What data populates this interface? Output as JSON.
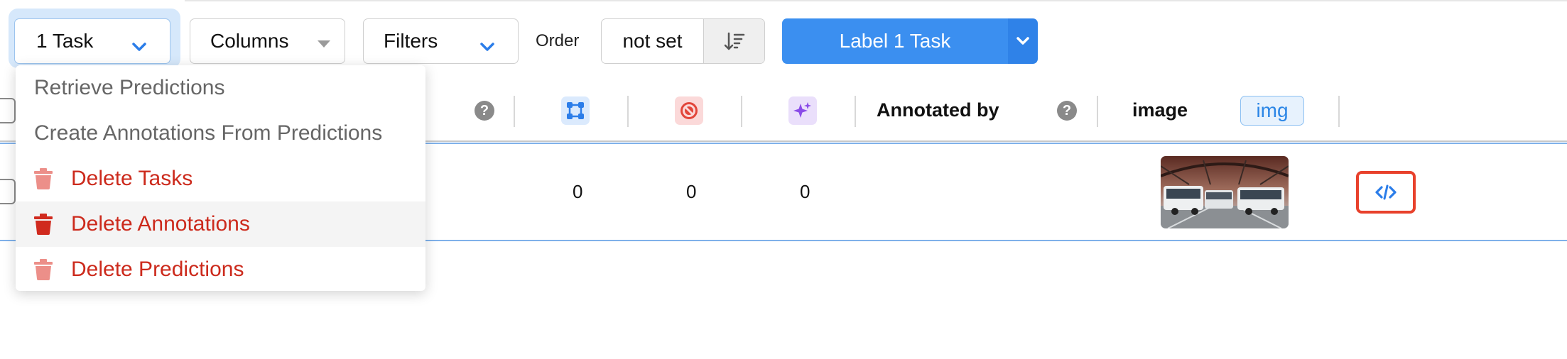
{
  "toolbar": {
    "tasks_label": "1 Task",
    "columns_label": "Columns",
    "filters_label": "Filters",
    "order_label": "Order",
    "order_value": "not set",
    "label_button": "Label 1 Task"
  },
  "dropdown": {
    "items": [
      {
        "label": "Retrieve Predictions",
        "danger": false
      },
      {
        "label": "Create Annotations From Predictions",
        "danger": false
      },
      {
        "label": "Delete Tasks",
        "danger": true
      },
      {
        "label": "Delete Annotations",
        "danger": true,
        "hovered": true
      },
      {
        "label": "Delete Predictions",
        "danger": true
      }
    ]
  },
  "table": {
    "headers": {
      "annotated_by": "Annotated by",
      "image": "image",
      "img_tag": "img"
    },
    "row": {
      "annotations": "0",
      "cancelled": "0",
      "predictions": "0"
    }
  },
  "icons": {
    "tasks_chevron": "chevron-down-icon",
    "filters_chevron": "chevron-down-icon",
    "sort": "sort-descending-icon",
    "help": "question-circle-icon",
    "annotations": "bounding-box-icon",
    "cancelled": "ban-icon",
    "predictions": "sparkles-icon",
    "trash": "trash-icon",
    "code": "code-icon"
  },
  "colors": {
    "primary": "#3b8ff0",
    "danger": "#cc2a1c",
    "highlight_border": "#e8412c"
  }
}
